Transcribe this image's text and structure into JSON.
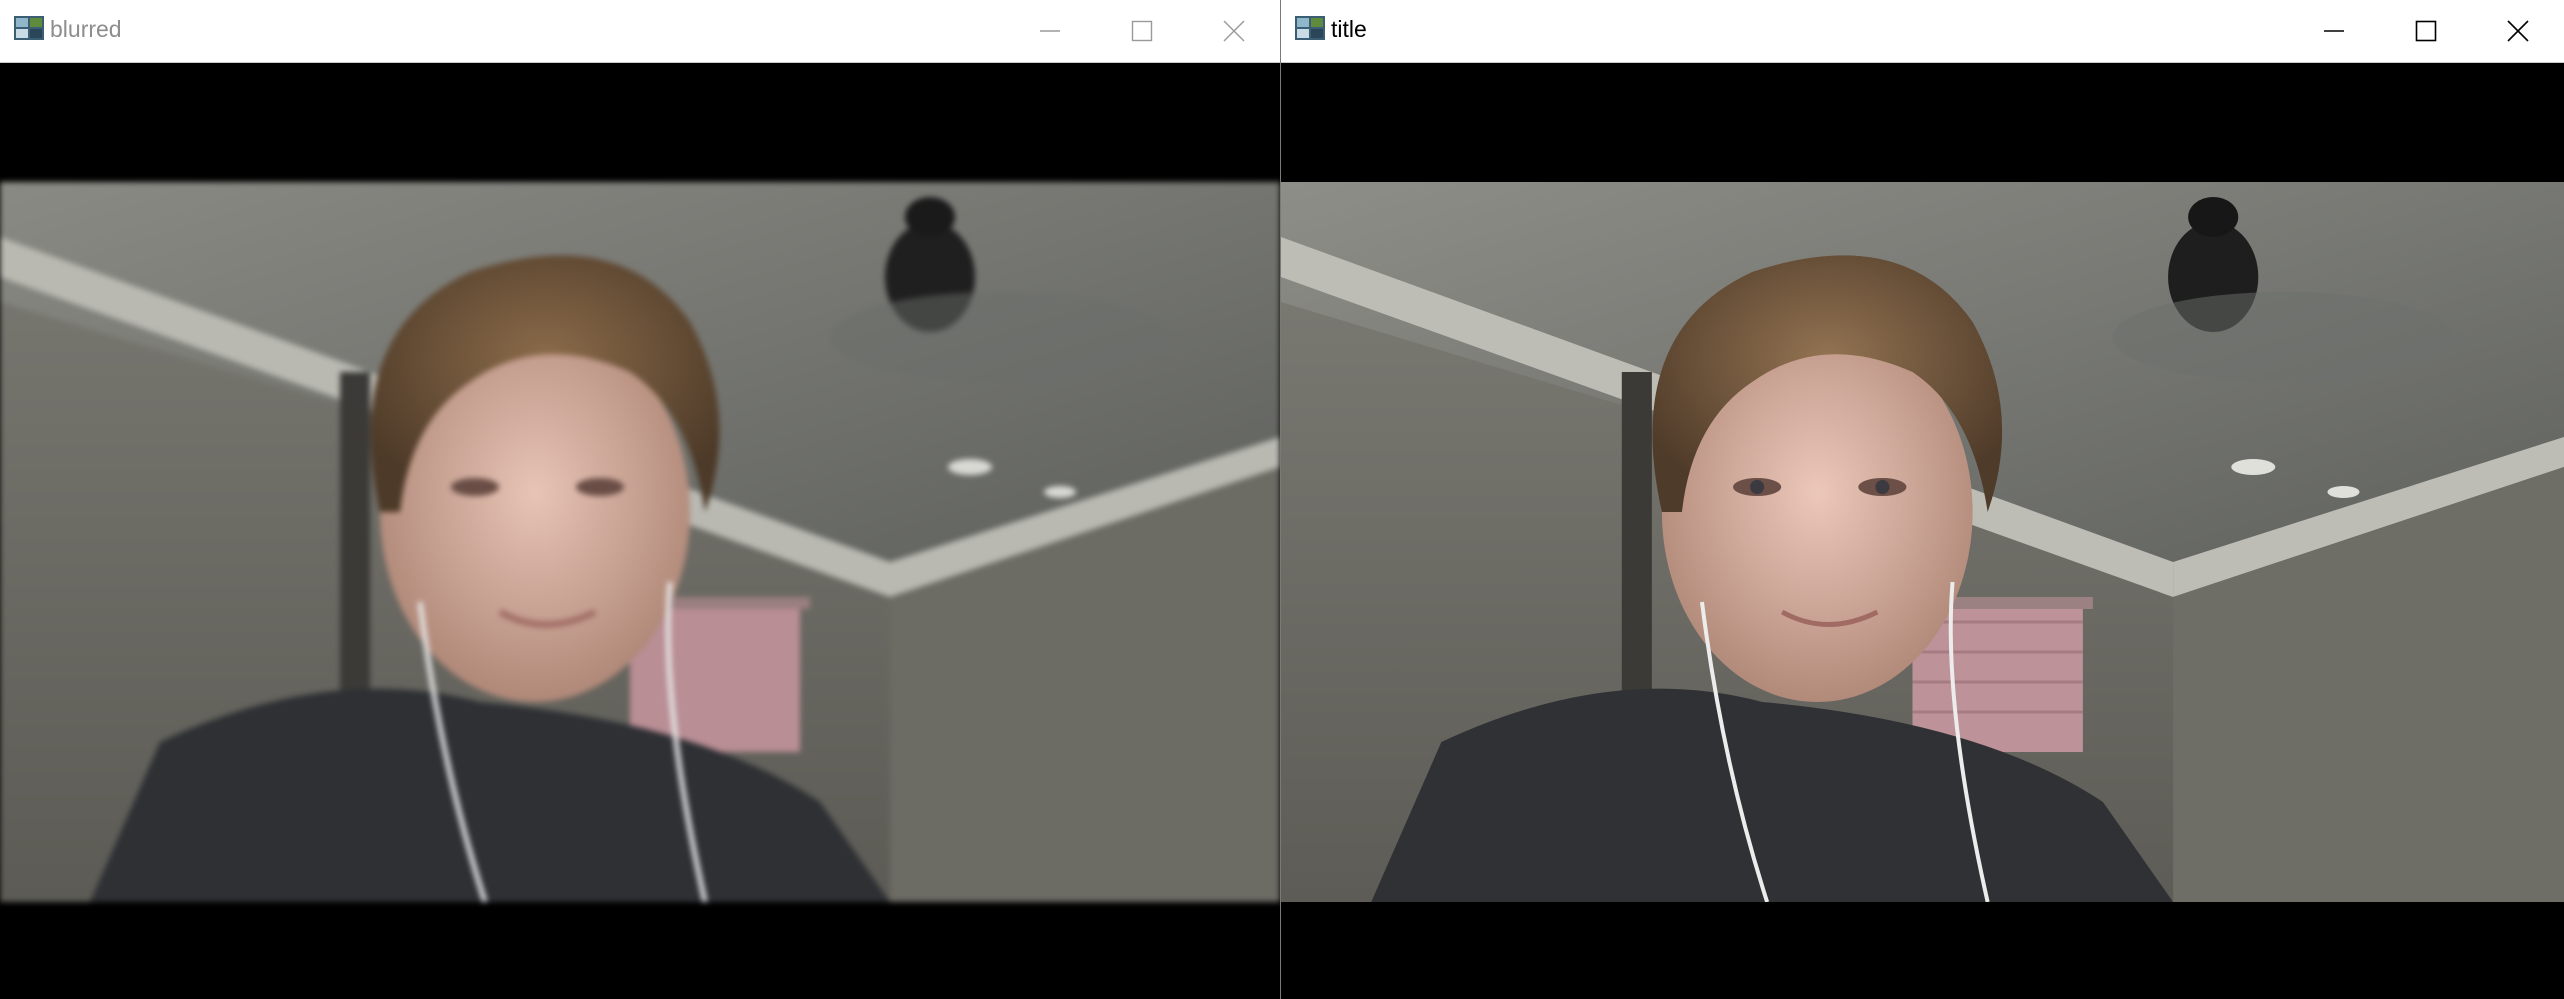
{
  "windows": [
    {
      "id": "left",
      "title": "blurred",
      "active": false,
      "content": "webcam-frame-blurred"
    },
    {
      "id": "right",
      "title": "title",
      "active": true,
      "content": "webcam-frame"
    }
  ],
  "captionButtons": {
    "minimize": "minimize-icon",
    "maximize": "maximize-icon",
    "close": "close-icon"
  },
  "colors": {
    "titlebarBg": "#ffffff",
    "inactiveTitle": "#8d8d8d",
    "activeTitle": "#000000",
    "clientBg": "#000000"
  }
}
